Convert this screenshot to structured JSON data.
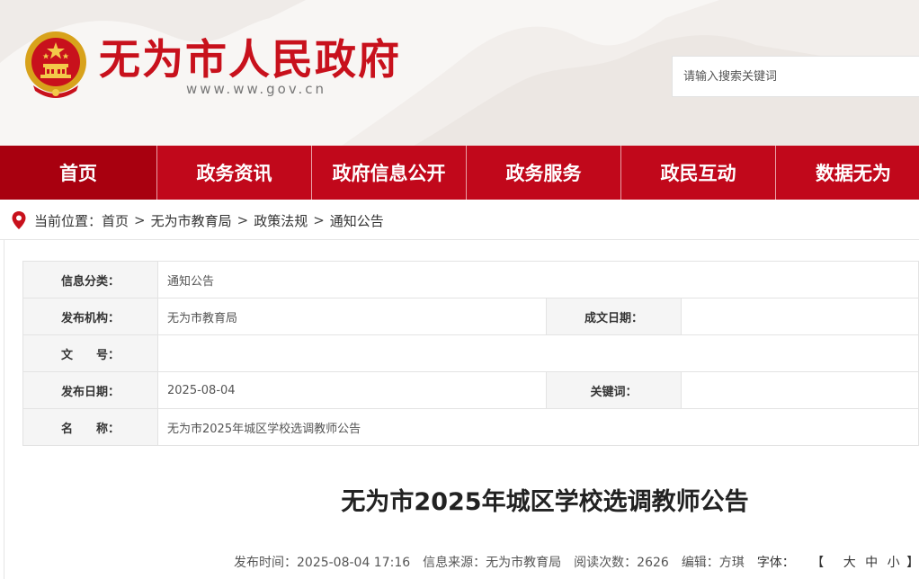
{
  "header": {
    "site_title": "无为市人民政府",
    "site_domain": "www.ww.gov.cn",
    "search_placeholder": "请输入搜索关键词"
  },
  "nav": {
    "items": [
      {
        "label": "首页"
      },
      {
        "label": "政务资讯"
      },
      {
        "label": "政府信息公开"
      },
      {
        "label": "政务服务"
      },
      {
        "label": "政民互动"
      },
      {
        "label": "数据无为"
      }
    ]
  },
  "breadcrumb": {
    "prefix": "当前位置：",
    "items": [
      "首页",
      "无为市教育局",
      "政策法规",
      "通知公告"
    ],
    "separator": ">"
  },
  "info": {
    "category_label": "信息分类：",
    "category_value": "通知公告",
    "issuer_label": "发布机构：",
    "issuer_value": "无为市教育局",
    "written_date_label": "成文日期：",
    "written_date_value": "",
    "doc_no_label": "文　　号：",
    "doc_no_value": "",
    "publish_date_label": "发布日期：",
    "publish_date_value": "2025-08-04",
    "keywords_label": "关键词：",
    "keywords_value": "",
    "name_label": "名　　称：",
    "name_value": "无为市2025年城区学校选调教师公告"
  },
  "article": {
    "title": "无为市2025年城区学校选调教师公告",
    "meta_publish_time": "发布时间：2025-08-04 17:16",
    "meta_source": "信息来源：无为市教育局",
    "meta_views": "阅读次数：2626",
    "meta_editor": "编辑：方琪",
    "font_label": "字体：",
    "font_open": "【",
    "font_large": "大",
    "font_medium": "中",
    "font_small": "小",
    "font_close": "】"
  },
  "colors": {
    "brand_red": "#c1081b",
    "nav_active": "#a8000f",
    "title_red": "#c8111c"
  }
}
